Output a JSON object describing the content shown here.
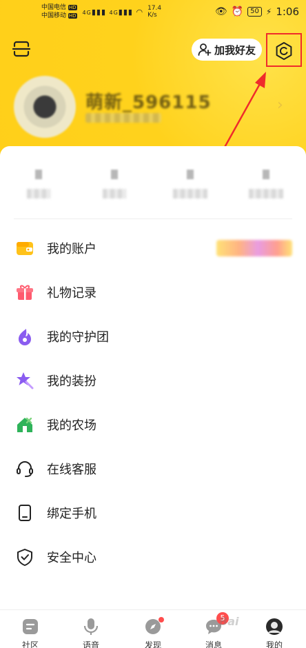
{
  "status_bar": {
    "carrier_1": "中国电信",
    "carrier_2": "中国移动",
    "hd_1": "HD",
    "hd_2": "HD",
    "network_1": "4G",
    "network_2": "4G",
    "speed_value": "17.4",
    "speed_unit": "K/s",
    "battery": "50",
    "time": "1:06"
  },
  "header": {
    "add_friend_label": "加我好友",
    "username": "萌新_596115",
    "colors": {
      "accent": "#ffd21c",
      "highlight": "#ef2b2b"
    }
  },
  "menu": {
    "items": [
      {
        "label": "我的账户",
        "icon": "wallet-icon"
      },
      {
        "label": "礼物记录",
        "icon": "gift-icon"
      },
      {
        "label": "我的守护团",
        "icon": "guard-icon"
      },
      {
        "label": "我的装扮",
        "icon": "star-wand-icon"
      },
      {
        "label": "我的农场",
        "icon": "farm-icon"
      },
      {
        "label": "在线客服",
        "icon": "headset-icon"
      },
      {
        "label": "绑定手机",
        "icon": "phone-icon"
      },
      {
        "label": "安全中心",
        "icon": "shield-icon"
      }
    ]
  },
  "tabbar": {
    "tabs": [
      {
        "label": "社区",
        "icon": "community-icon"
      },
      {
        "label": "语音",
        "icon": "voice-icon"
      },
      {
        "label": "发现",
        "icon": "discover-icon"
      },
      {
        "label": "消息",
        "icon": "message-icon",
        "badge": "5"
      },
      {
        "label": "我的",
        "icon": "profile-icon"
      }
    ]
  },
  "watermark": "Bai"
}
